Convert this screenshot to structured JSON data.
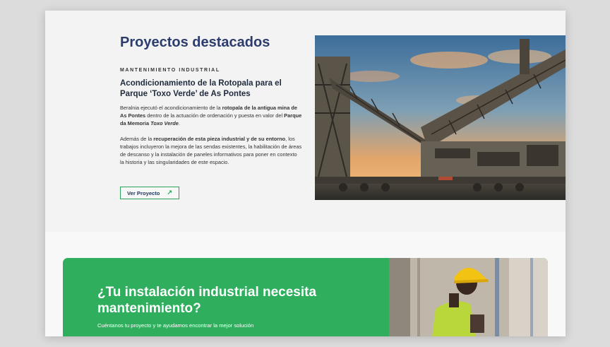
{
  "featured": {
    "title": "Proyectos destacados",
    "category": "MANTENIMIENTO INDUSTRIAL",
    "project_title": "Acondicionamiento de la Rotopala para el Parque ‘Toxo Verde’ de As Pontes",
    "p1": {
      "t1": "Beralnia ejecutó el acondicionamiento de la ",
      "b1": "rotopala de la antigua mina de As Pontes",
      "t2": " dentro de la actuación de ordenación y puesta en valor del ",
      "b2": "Parque da Memoria ",
      "bi": "Toxo Verde",
      "t3": "."
    },
    "p2": {
      "t1": "Además de la ",
      "b1": "recuperación de esta pieza industrial y de su entorno",
      "t2": ", los trabajos incluyeron la mejora de las sendas existentes, la habilitación de áreas de descanso y la instalación de paneles informativos para poner en contexto la historia y las singularidades de este espacio."
    },
    "button_label": "Ver Proyecto",
    "image_alt": "Rotopala en el Parque Toxo Verde"
  },
  "cta": {
    "title": "¿Tu instalación industrial necesita mantenimiento?",
    "subtitle": "Cuéntanos tu proyecto y te ayudamos encontrar la mejor solución",
    "image_alt": "Operario con casco amarillo"
  },
  "icons": {
    "button_arrow": "arrow-up-right-icon"
  },
  "colors": {
    "title_navy": "#2c3c6c",
    "accent_green": "#2fae5d"
  }
}
